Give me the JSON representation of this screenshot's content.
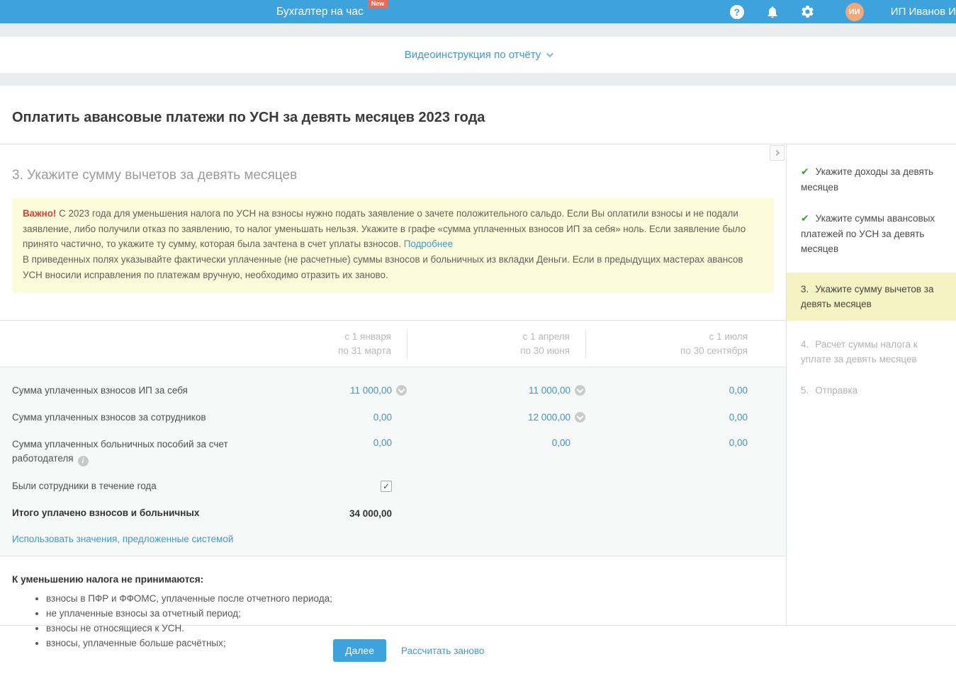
{
  "topbar": {
    "title": "Бухгалтер на час",
    "badge": "New",
    "avatar_initials": "ИИ",
    "user": "ИП Иванов И"
  },
  "video_link_label": "Видеоинструкция по отчёту",
  "page_title": "Оплатить авансовые платежи по УСН за девять месяцев 2023 года",
  "section_title": "3. Укажите сумму вычетов за девять месяцев",
  "notice": {
    "important_label": "Важно!",
    "p1": "С 2023 года для уменьшения налога по УСН на взносы нужно подать заявление о зачете положительного сальдо. Если Вы оплатили взносы и не подали заявление, либо получили отказ по заявлению, то налог уменьшать нельзя. Укажите в графе «сумма уплаченных взносов ИП за себя» ноль. Если заявление было принято частично, то укажите ту сумму, которая была зачтена в счет уплаты взносов.",
    "more_link": "Подробнее",
    "p2": "В приведенных полях указывайте фактически уплаченные (не расчетные) суммы взносов и больничных из вкладки Деньги. Если в предыдущих мастерах авансов УСН вносили исправления по платежам вручную, необходимо отразить их заново."
  },
  "table": {
    "periods": [
      {
        "line1": "с 1 января",
        "line2": "по 31 марта"
      },
      {
        "line1": "с 1 апреля",
        "line2": "по 30 июня"
      },
      {
        "line1": "с 1 июля",
        "line2": "по 30 сентября"
      }
    ],
    "rows": [
      {
        "label": "Сумма уплаченных взносов ИП за себя",
        "values": [
          "11 000,00",
          "11 000,00",
          "0,00"
        ]
      },
      {
        "label": "Сумма уплаченных взносов за сотрудников",
        "values": [
          "0,00",
          "12 000,00",
          "0,00"
        ]
      },
      {
        "label": "Сумма уплаченных больничных пособий за счет работодателя",
        "values": [
          "0,00",
          "0,00",
          "0,00"
        ]
      }
    ],
    "checkbox_row_label": "Были сотрудники в течение года",
    "checkbox_checked": true,
    "total_label": "Итого уплачено взносов и больничных",
    "total_value": "34 000,00",
    "use_system_link": "Использовать значения, предложенные системой"
  },
  "exclusions": {
    "title": "К уменьшению налога не принимаются:",
    "items": [
      "взносы в ПФР и ФФОМС, уплаченные после отчетного периода;",
      "не уплаченные взносы за отчетный период;",
      "взносы не относящиеся к УСН.",
      "взносы, уплаченные больше расчётных;"
    ]
  },
  "sidebar": {
    "steps": [
      {
        "label": "Укажите доходы за девять месяцев",
        "state": "done"
      },
      {
        "label": "Укажите суммы авансовых платежей по УСН за девять месяцев",
        "state": "done"
      },
      {
        "number": "3.",
        "label": "Укажите сумму вычетов за девять месяцев",
        "state": "active"
      },
      {
        "number": "4.",
        "label": "Расчет суммы налога к уплате за девять месяцев",
        "state": "pending"
      },
      {
        "number": "5.",
        "label": "Отправка",
        "state": "pending"
      }
    ]
  },
  "footer": {
    "next_button": "Далее",
    "recalculate_link": "Рассчитать заново"
  },
  "colors": {
    "topbar_blue": "#3ea2dd",
    "badge_red": "#e96b56",
    "avatar_orange": "#f2a87b",
    "link_blue": "#3d9ad1",
    "value_blue": "#3e93cf",
    "notice_yellow": "#fcfcdb",
    "active_step_yellow": "#f5f2c4",
    "check_green": "#3f9e3b",
    "important_red": "#e03c31"
  }
}
